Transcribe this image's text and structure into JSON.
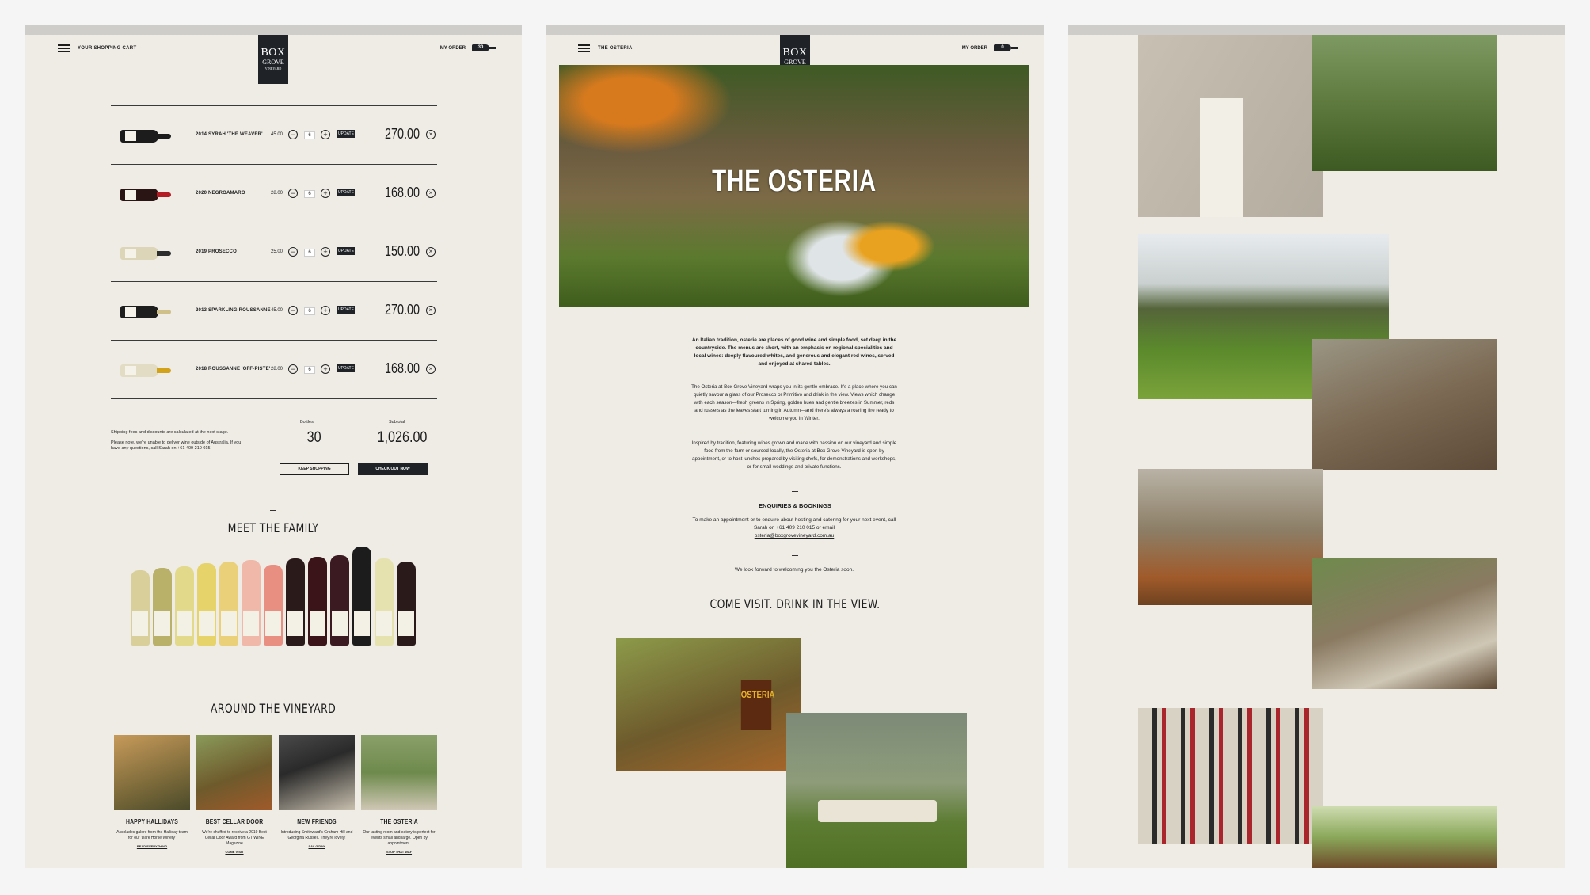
{
  "panel1": {
    "header_left": "YOUR SHOPPING CART",
    "logo": {
      "line1": "BOX",
      "line2": "GROVE",
      "line3": "VINEYARD"
    },
    "header_right": "MY ORDER",
    "order_count": "30",
    "update_label": "UPDATE",
    "items": [
      {
        "name": "2014 SYRAH 'THE WEAVER'",
        "unit": "45.00",
        "qty": "6",
        "total": "270.00",
        "color": "#1c1c1c",
        "neck": "#1c1c1c"
      },
      {
        "name": "2020 NEGROAMARO",
        "unit": "28.00",
        "qty": "6",
        "total": "168.00",
        "color": "#2a1414",
        "neck": "#b41b22"
      },
      {
        "name": "2019 PROSECCO",
        "unit": "25.00",
        "qty": "6",
        "total": "150.00",
        "color": "#dcd5b8",
        "neck": "#2d2d2d"
      },
      {
        "name": "2013 SPARKLING ROUSSANNE",
        "unit": "45.00",
        "qty": "6",
        "total": "270.00",
        "color": "#1e1e1e",
        "neck": "#cfc08a"
      },
      {
        "name": "2018 ROUSSANNE 'OFF-PISTE'",
        "unit": "28.00",
        "qty": "6",
        "total": "168.00",
        "color": "#e2dcc4",
        "neck": "#d2a21a"
      }
    ],
    "summary": {
      "note1": "Shipping fees and discounts are calculated at the next stage.",
      "note2": "Please note, we're unable to deliver wine outside of Australia. If you have any questions, call Sarah on +61 409 210 015",
      "bottles_label": "Bottles",
      "bottles": "30",
      "subtotal_label": "Subtotal",
      "subtotal": "1,026.00",
      "keep_shopping": "KEEP SHOPPING",
      "checkout": "CHECK OUT NOW"
    },
    "meet_family": "MEET THE FAMILY",
    "around": "AROUND THE VINEYARD",
    "tiles": [
      {
        "title": "HAPPY HALLIDAYS",
        "desc": "Accolades galore from the Halliday team for our 'Dark Horse Winery'",
        "link": "READ EVERYTHING"
      },
      {
        "title": "BEST CELLAR DOOR",
        "desc": "We're chuffed to receive a 2019 Best Cellar Door Award from GT WINE Magazine",
        "link": "COME VISIT"
      },
      {
        "title": "NEW FRIENDS",
        "desc": "Introducing Smithward's Graham Hill and Georgina Russell. They're lovely!",
        "link": "SAY G'DAY"
      },
      {
        "title": "THE OSTERIA",
        "desc": "Our tasting room and eatery is perfect for events small and large. Open by appointment.",
        "link": "STOP THAT WAY"
      }
    ]
  },
  "panel2": {
    "header_left": "THE OSTERIA",
    "header_right": "MY ORDER",
    "order_count": "0",
    "hero_title": "THE OSTERIA",
    "intro": "An Italian tradition, osterie are places of good wine and simple food, set deep in the countryside. The menus are short, with an emphasis on regional specialities and local wines: deeply flavoured whites, and generous and elegant red wines, served and enjoyed at shared tables.",
    "para2": "The Osteria at Box Grove Vineyard wraps you in its gentle embrace. It's a place where you can quietly savour a glass of our Prosecco or Primitivo and drink in the view. Views which change with each season—fresh greens in Spring, golden hues and gentle breezes in Summer, reds and russets as the leaves start turning in Autumn—and there's always a roaring fire ready to welcome you in Winter.",
    "para3": "Inspired by tradition, featuring wines grown and made with passion on our vineyard and simple food from the farm or sourced locally, the Osteria at Box Grove Vineyard is open by appointment, or to host lunches prepared by visiting chefs, for demonstrations and workshops, or for small weddings and private functions.",
    "enquiries_title": "ENQUIRIES & BOOKINGS",
    "enquiries_text": "To make an appointment or to enquire about hosting and catering for your next event, call Sarah on +61 409 210 015 or email",
    "email": "osteria@boxgrovevineyard.com.au",
    "welcome": "We look forward to welcoming you the Osteria soon.",
    "come_visit": "COME VISIT. DRINK IN THE VIEW.",
    "sign_text": "OSTERIA"
  }
}
